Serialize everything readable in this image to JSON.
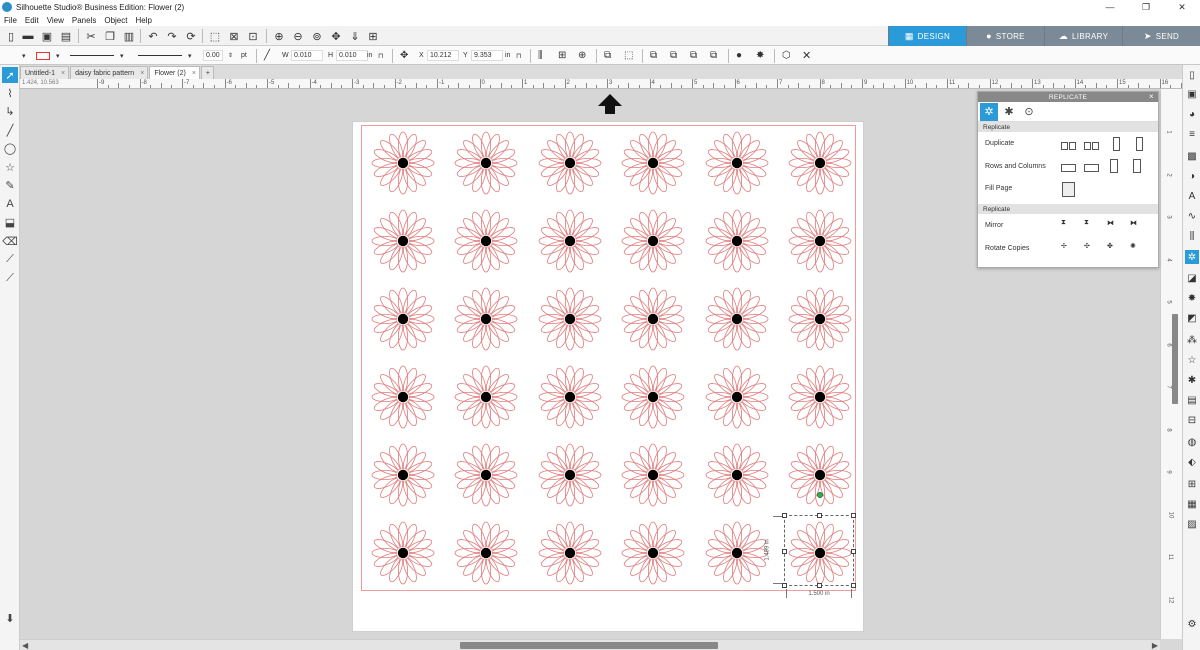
{
  "window": {
    "title": "Silhouette Studio® Business Edition: Flower (2)",
    "minimize": "—",
    "restore": "❐",
    "close": "✕"
  },
  "menu": [
    "File",
    "Edit",
    "View",
    "Panels",
    "Object",
    "Help"
  ],
  "top_tabs": [
    {
      "label": "DESIGN",
      "icon": "design-icon",
      "active": true
    },
    {
      "label": "STORE",
      "icon": "store-icon",
      "active": false
    },
    {
      "label": "LIBRARY",
      "icon": "library-icon",
      "active": false
    },
    {
      "label": "SEND",
      "icon": "send-icon",
      "active": false
    }
  ],
  "line": {
    "thickness": "0.00",
    "unit": "pt"
  },
  "size": {
    "w_label": "W",
    "w_value": "0.010",
    "h_label": "H",
    "h_value": "0.010",
    "unit": "in"
  },
  "position": {
    "x_label": "X",
    "x_value": "10.212",
    "y_label": "Y",
    "y_value": "9.353",
    "unit": "in"
  },
  "doc_tabs": [
    {
      "label": "Untitled-1",
      "active": false
    },
    {
      "label": "daisy fabric pattern",
      "active": false
    },
    {
      "label": "Flower (2)",
      "active": true
    }
  ],
  "add_tab": "+",
  "coords": "1.424, 10.563",
  "ruler_top": [
    "-9",
    "-8",
    "-7",
    "-6",
    "-5",
    "-4",
    "-3",
    "-2",
    "-1",
    "0",
    "1",
    "2",
    "3",
    "4",
    "5",
    "6",
    "7",
    "8",
    "9",
    "10",
    "11",
    "12",
    "13",
    "14",
    "15",
    "16",
    "17",
    "18"
  ],
  "ruler_side": [
    "1",
    "2",
    "3",
    "4",
    "5",
    "6",
    "7",
    "8",
    "9",
    "10",
    "11",
    "12"
  ],
  "selection": {
    "width": "1.500 in",
    "height": "1.499 in"
  },
  "replicate_panel": {
    "title": "REPLICATE",
    "close": "×",
    "sections": [
      {
        "header": "Replicate",
        "rows": [
          {
            "label": "Duplicate"
          },
          {
            "label": "Rows and Columns"
          },
          {
            "label": "Fill Page"
          }
        ]
      },
      {
        "header": "Replicate",
        "rows": [
          {
            "label": "Mirror"
          },
          {
            "label": "Rotate Copies"
          }
        ]
      }
    ]
  },
  "colors": {
    "accent": "#2a9bd8",
    "flower_outline": "#e07a7a",
    "center": "#000000",
    "cut_border": "#f19a9a"
  },
  "grid": {
    "rows": 6,
    "cols": 6
  }
}
